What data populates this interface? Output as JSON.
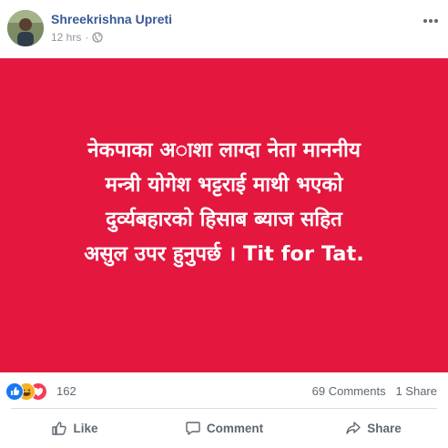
{
  "post": {
    "author": "Shreekrishna Upreti",
    "time": "12 hrs",
    "privacy_icon": "globe-icon",
    "image_text": [
      "नेकपाका अाशा लाग्दा नेता माननीय",
      "मन्त्री योगेश भट्टराई माथी भएको",
      "दुर्व्यबहारको हिसाब ब्याज सहित",
      "असुल उपर हुनुपर्छ । Tit for Tat."
    ],
    "image_bg": "#e4173f"
  },
  "reactions": {
    "icons": [
      "like-icon",
      "haha-icon",
      "love-icon"
    ],
    "count": "162",
    "comments": "69 Comments",
    "shares": "1 Share"
  },
  "actions": {
    "like": "Like",
    "comment": "Comment",
    "share": "Share"
  },
  "colors": {
    "link": "#385898",
    "muted": "#606770",
    "like_blue": "#1877f2",
    "love_red": "#f33e58"
  }
}
